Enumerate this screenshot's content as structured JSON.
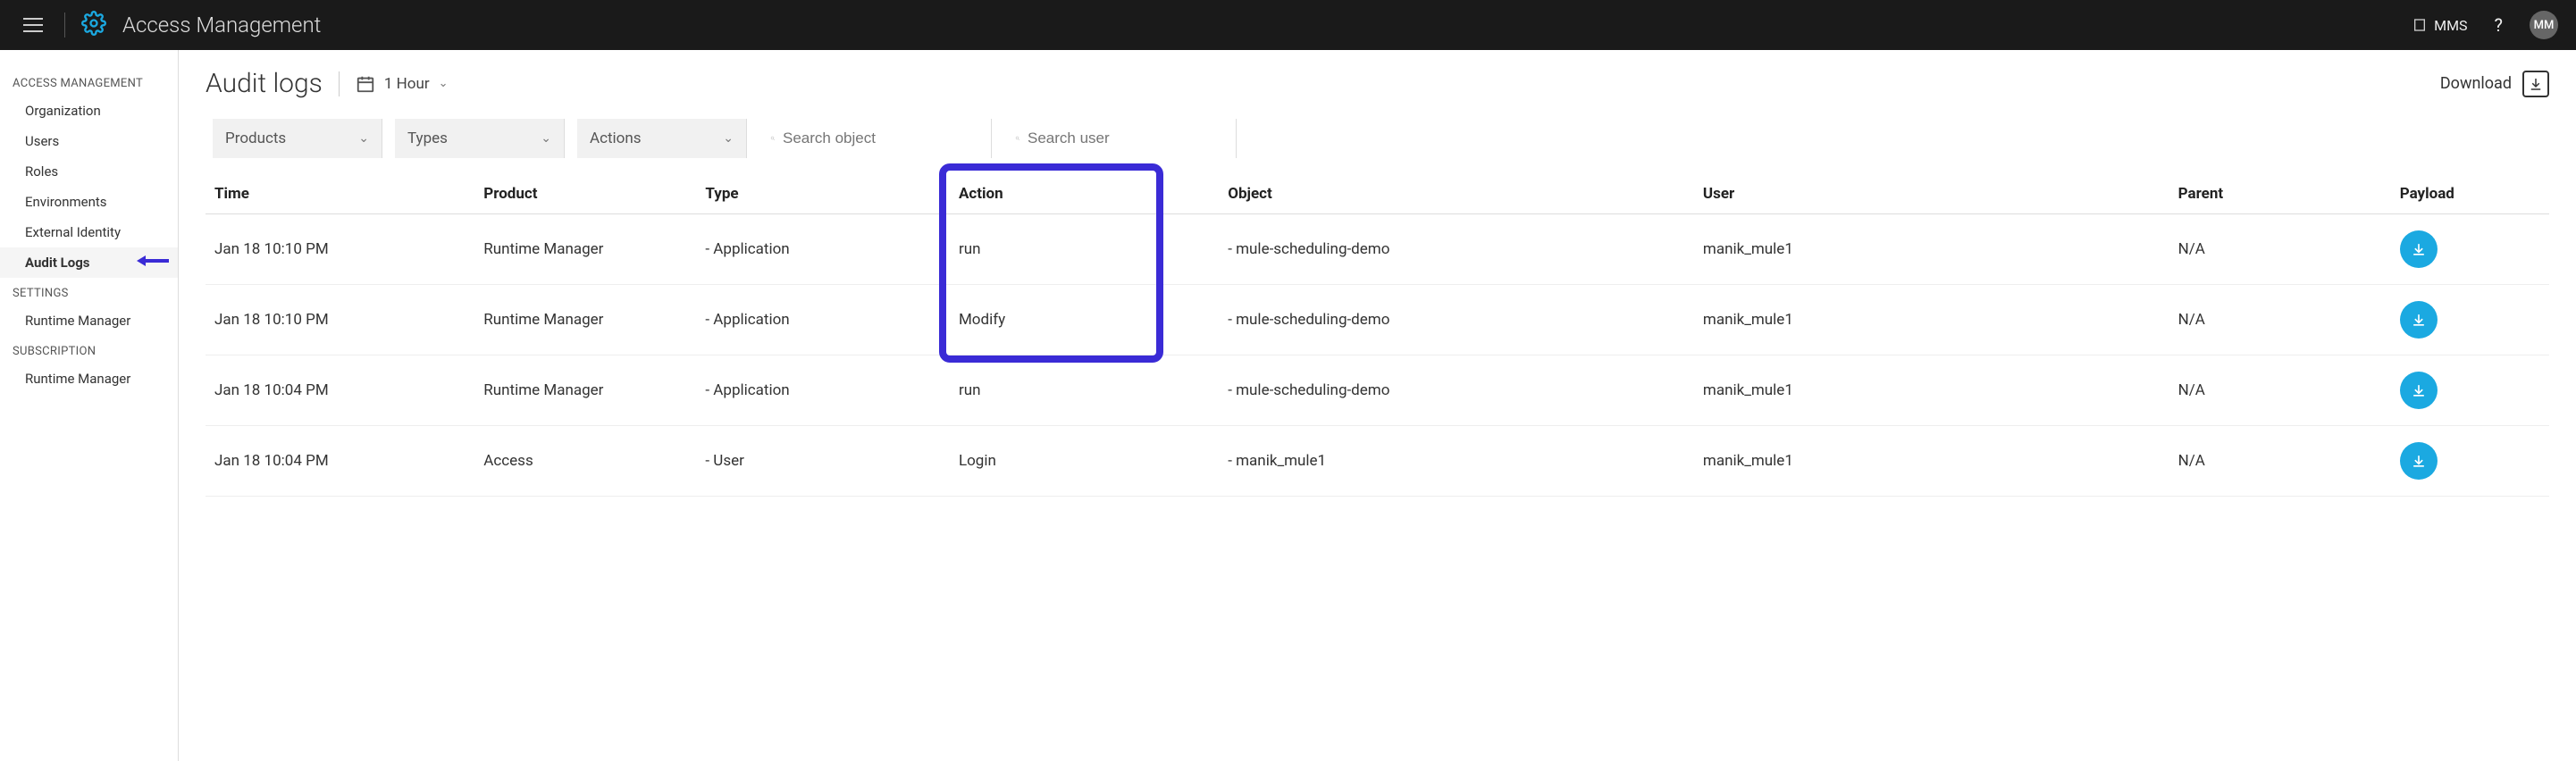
{
  "topbar": {
    "title": "Access Management",
    "org": "MMS",
    "help": "?",
    "avatar_initials": "MM"
  },
  "sidebar": {
    "sections": [
      {
        "heading": "ACCESS MANAGEMENT",
        "items": [
          {
            "label": "Organization",
            "active": false
          },
          {
            "label": "Users",
            "active": false
          },
          {
            "label": "Roles",
            "active": false
          },
          {
            "label": "Environments",
            "active": false
          },
          {
            "label": "External Identity",
            "active": false
          },
          {
            "label": "Audit Logs",
            "active": true
          }
        ]
      },
      {
        "heading": "SETTINGS",
        "items": [
          {
            "label": "Runtime Manager",
            "active": false
          }
        ]
      },
      {
        "heading": "SUBSCRIPTION",
        "items": [
          {
            "label": "Runtime Manager",
            "active": false
          }
        ]
      }
    ]
  },
  "page": {
    "title": "Audit logs",
    "time_range": "1 Hour",
    "download_label": "Download"
  },
  "filters": {
    "products": "Products",
    "types": "Types",
    "actions": "Actions",
    "search_object_placeholder": "Search object",
    "search_user_placeholder": "Search user"
  },
  "table": {
    "headers": {
      "time": "Time",
      "product": "Product",
      "type": "Type",
      "action": "Action",
      "object": "Object",
      "user": "User",
      "parent": "Parent",
      "payload": "Payload"
    },
    "rows": [
      {
        "time": "Jan 18 10:10 PM",
        "product": "Runtime Manager",
        "type": "- Application",
        "action": "run",
        "object": "- mule-scheduling-demo",
        "user": "manik_mule1",
        "parent": "N/A"
      },
      {
        "time": "Jan 18 10:10 PM",
        "product": "Runtime Manager",
        "type": "- Application",
        "action": "Modify",
        "object": "- mule-scheduling-demo",
        "user": "manik_mule1",
        "parent": "N/A"
      },
      {
        "time": "Jan 18 10:04 PM",
        "product": "Runtime Manager",
        "type": "- Application",
        "action": "run",
        "object": "- mule-scheduling-demo",
        "user": "manik_mule1",
        "parent": "N/A"
      },
      {
        "time": "Jan 18 10:04 PM",
        "product": "Access",
        "type": "- User",
        "action": "Login",
        "object": "- manik_mule1",
        "user": "manik_mule1",
        "parent": "N/A"
      }
    ]
  },
  "highlight": {
    "column": "action"
  }
}
